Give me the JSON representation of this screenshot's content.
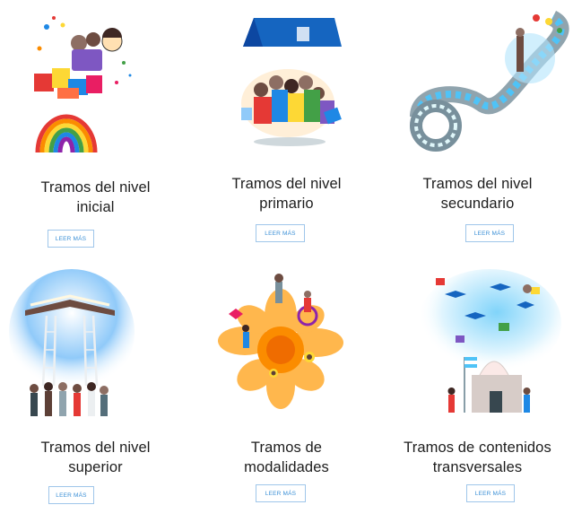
{
  "cards": [
    {
      "title_l1": "Tramos del nivel",
      "title_l2": "inicial",
      "button": "LEER MÁS"
    },
    {
      "title_l1": "Tramos del nivel",
      "title_l2": "primario",
      "button": "LEER MÁS"
    },
    {
      "title_l1": "Tramos del nivel",
      "title_l2": "secundario",
      "button": "LEER MÁS"
    },
    {
      "title_l1": "Tramos del nivel",
      "title_l2": "superior",
      "button": "LEER MÁS"
    },
    {
      "title_l1": "Tramos de",
      "title_l2": "modalidades",
      "button": "LEER MÁS"
    },
    {
      "title_l1": "Tramos de contenidos",
      "title_l2": "transversales",
      "button": "LEER MÁS"
    }
  ],
  "colors": {
    "button_text": "#3a8fd6",
    "button_border": "#9fc6ea",
    "title": "#1d1d1d"
  },
  "icons": [
    "inicial-illustration-icon",
    "primario-illustration-icon",
    "secundario-illustration-icon",
    "superior-illustration-icon",
    "modalidades-illustration-icon",
    "transversales-illustration-icon"
  ]
}
